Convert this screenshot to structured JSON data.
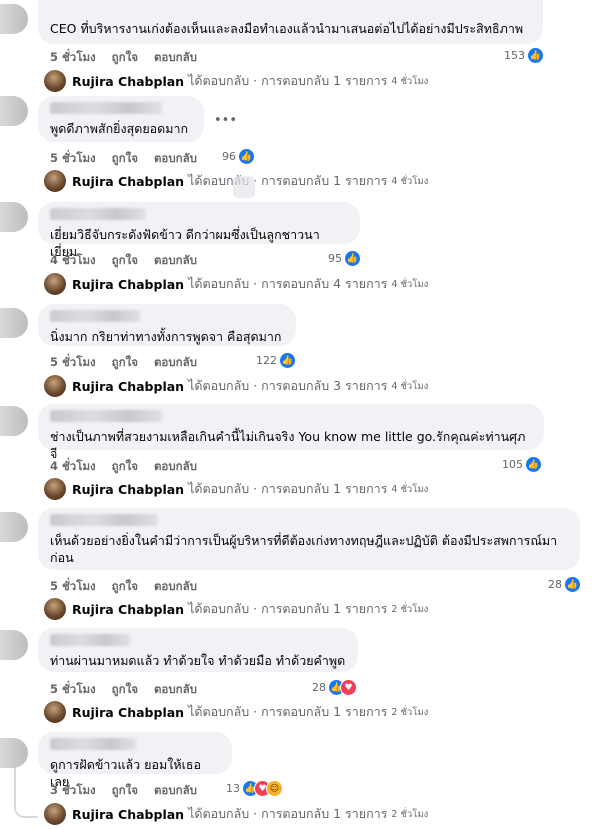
{
  "labels": {
    "like": "ถูกใจ",
    "reply": "ตอบกลับ"
  },
  "comments": [
    {
      "text": "CEO ที่บริหารงานเก่งต้องเห็นและลงมือทำเองแล้วนำมาเสนอต่อไปได้อย่างมีประสิทธิภาพ",
      "time": "5 ชั่วโมง",
      "reactions": "153",
      "reply_summary": {
        "name": "Rujira Chabplan",
        "text": "ได้ตอบกลับ · การตอบกลับ 1 รายการ",
        "time": "4 ชั่วโมง"
      }
    },
    {
      "text": "พูดดีภาพสักยิ่งสุดยอดมาก",
      "time": "5 ชั่วโมง",
      "reactions": "96",
      "reply_summary": {
        "name": "Rujira Chabplan",
        "text": "ได้ตอบกลับ · การตอบกลับ 1 รายการ",
        "time": "4 ชั่วโมง"
      }
    },
    {
      "text": "เยี่ยมวิธีจับกระดังฟัดข้าว ดีกว่าผมซึ่งเป็นลูกชาวนา เยี่ยม",
      "time": "4 ชั่วโมง",
      "reactions": "95",
      "reply_summary": {
        "name": "Rujira Chabplan",
        "text": "ได้ตอบกลับ · การตอบกลับ 4 รายการ",
        "time": "4 ชั่วโมง"
      }
    },
    {
      "text": "นิ่งมาก กริยาท่าทางทั้งการพูดจา คือสุดมาก",
      "time": "5 ชั่วโมง",
      "reactions": "122",
      "reply_summary": {
        "name": "Rujira Chabplan",
        "text": "ได้ตอบกลับ · การตอบกลับ 3 รายการ",
        "time": "4 ชั่วโมง"
      }
    },
    {
      "text": "ช่างเป็นภาพที่สวยงามเหลือเกินคำนี้ไม่เกินจริง You know me little go.รักคุณค่ะท่านศุภจี",
      "time": "4 ชั่วโมง",
      "reactions": "105",
      "reply_summary": {
        "name": "Rujira Chabplan",
        "text": "ได้ตอบกลับ · การตอบกลับ 1 รายการ",
        "time": "4 ชั่วโมง"
      }
    },
    {
      "text": "เห็นด้วยอย่างยิ่งในคำมีว่าการเป็นผู้บริหารที่ดีต้องเก่งทางทฤษฎีและปฏิบัติ ต้องมีประสพการณ์มาก่อน",
      "time": "5 ชั่วโมง",
      "reactions": "28",
      "reply_summary": {
        "name": "Rujira Chabplan",
        "text": "ได้ตอบกลับ · การตอบกลับ 1 รายการ",
        "time": "2 ชั่วโมง"
      }
    },
    {
      "text": "ท่านผ่านมาหมดแล้ว ทำด้วยใจ ทำด้วยมือ ทำด้วยคำพูด",
      "time": "5 ชั่วโมง",
      "reactions": "28",
      "reply_summary": {
        "name": "Rujira Chabplan",
        "text": "ได้ตอบกลับ · การตอบกลับ 1 รายการ",
        "time": "2 ชั่วโมง"
      }
    },
    {
      "text": "ดูการฝัดข้าวแล้ว ยอมให้เธอเลย",
      "time": "3 ชั่วโมง",
      "reactions": "13",
      "reply_summary": {
        "name": "Rujira Chabplan",
        "text": "ได้ตอบกลับ · การตอบกลับ 1 รายการ",
        "time": "2 ชั่วโมง"
      }
    }
  ],
  "icons": {
    "like": "like-icon",
    "heart": "heart-icon",
    "haha": "haha-icon",
    "more": "more-options-icon"
  },
  "colors": {
    "bubble": "#f0f2f5",
    "like_blue": "#1877f2",
    "heart_red": "#f33e58",
    "meta_gray": "#65676b"
  }
}
